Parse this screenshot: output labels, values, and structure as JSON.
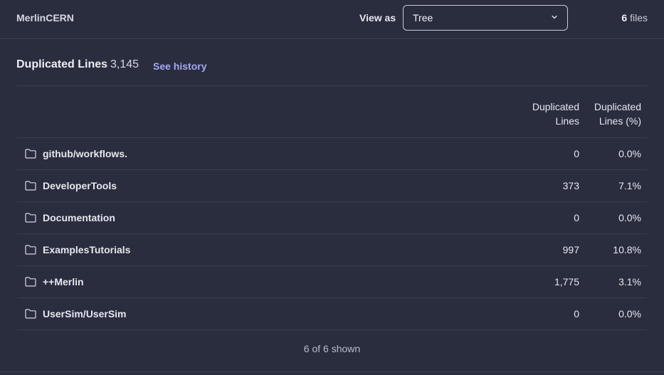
{
  "header": {
    "project_name": "MerlinCERN",
    "view_as_label": "View as",
    "view_as_value": "Tree",
    "files_count": "6",
    "files_label": "files"
  },
  "metric": {
    "title": "Duplicated Lines",
    "value": "3,145",
    "history_link": "See history"
  },
  "table": {
    "columns": [
      {
        "line1": "Duplicated",
        "line2": "Lines"
      },
      {
        "line1": "Duplicated",
        "line2": "Lines (%)"
      }
    ],
    "rows": [
      {
        "name": "github/workflows.",
        "lines": "0",
        "pct": "0.0%",
        "icon": "folder-icon"
      },
      {
        "name": "DeveloperTools",
        "lines": "373",
        "pct": "7.1%",
        "icon": "folder-icon"
      },
      {
        "name": "Documentation",
        "lines": "0",
        "pct": "0.0%",
        "icon": "folder-icon"
      },
      {
        "name": "ExamplesTutorials",
        "lines": "997",
        "pct": "10.8%",
        "icon": "folder-icon"
      },
      {
        "name": "++Merlin",
        "lines": "1,775",
        "pct": "3.1%",
        "icon": "folder-icon"
      },
      {
        "name": "UserSim/UserSim",
        "lines": "0",
        "pct": "0.0%",
        "icon": "folder-icon"
      }
    ]
  },
  "footer": {
    "shown_text": "6 of 6 shown"
  },
  "colors": {
    "background": "#2a2d3e",
    "link": "#a4a9f5",
    "border": "#3b3f52"
  }
}
